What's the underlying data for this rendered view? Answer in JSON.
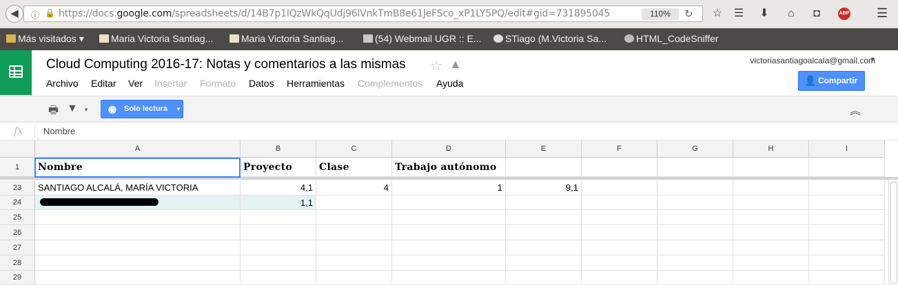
{
  "browser": {
    "url_prefix": "https://docs.",
    "url_domain": "google.com",
    "url_path": "/spreadsheets/d/14B7p1lQzWkQqUdj96lVnkTmB8e61JeFSco_xP1LY5PQ/edit#gid=731895045",
    "zoom": "110%",
    "bookmarks": [
      "Más visitados ▾",
      "Maria Victoria Santiag...",
      "Maria Victoria Santiag...",
      "(54) Webmail UGR :: E...",
      "STiago (M.Victoria Sa...",
      "HTML_CodeSniffer"
    ]
  },
  "sheet": {
    "title": "Cloud Computing 2016-17: Notas y comentarios a las mismas",
    "account": "victoriasantiagoalcala@gmail.com",
    "share_label": "Compartir",
    "menu": [
      {
        "label": "Archivo",
        "enabled": true
      },
      {
        "label": "Editar",
        "enabled": true
      },
      {
        "label": "Ver",
        "enabled": true
      },
      {
        "label": "Insertar",
        "enabled": false
      },
      {
        "label": "Formato",
        "enabled": false
      },
      {
        "label": "Datos",
        "enabled": true
      },
      {
        "label": "Herramientas",
        "enabled": true
      },
      {
        "label": "Complementos",
        "enabled": false
      },
      {
        "label": "Ayuda",
        "enabled": true
      }
    ],
    "readonly_label": "Solo lectura",
    "formula_icon": "fx",
    "formula_value": "Nombre",
    "columns": [
      "A",
      "B",
      "C",
      "D",
      "E",
      "F",
      "G",
      "H",
      "I"
    ],
    "rows": [
      {
        "num": "1",
        "cells": [
          "Nombre",
          "Proyecto",
          "Clase",
          "Trabajo autónomo",
          "",
          "",
          "",
          "",
          ""
        ]
      },
      {
        "num": "23",
        "cells": [
          "SANTIAGO ALCALÁ, MARÍA VICTORIA",
          "4,1",
          "4",
          "1",
          "9,1",
          "",
          "",
          "",
          ""
        ]
      },
      {
        "num": "24",
        "cells": [
          "",
          "1,1",
          "",
          "",
          "",
          "",
          "",
          "",
          ""
        ]
      },
      {
        "num": "25",
        "cells": [
          "",
          "",
          "",
          "",
          "",
          "",
          "",
          "",
          ""
        ]
      },
      {
        "num": "26",
        "cells": [
          "",
          "",
          "",
          "",
          "",
          "",
          "",
          "",
          ""
        ]
      },
      {
        "num": "27",
        "cells": [
          "",
          "",
          "",
          "",
          "",
          "",
          "",
          "",
          ""
        ]
      },
      {
        "num": "28",
        "cells": [
          "",
          "",
          "",
          "",
          "",
          "",
          "",
          "",
          ""
        ]
      },
      {
        "num": "29",
        "cells": [
          "",
          "",
          "",
          "",
          "",
          "",
          "",
          "",
          ""
        ]
      }
    ]
  },
  "colors": {
    "sheets_green": "#0f9d58",
    "button_blue": "#4d90fe",
    "selection_blue": "#4285f4",
    "highlight_row": "#e4f4f4"
  }
}
